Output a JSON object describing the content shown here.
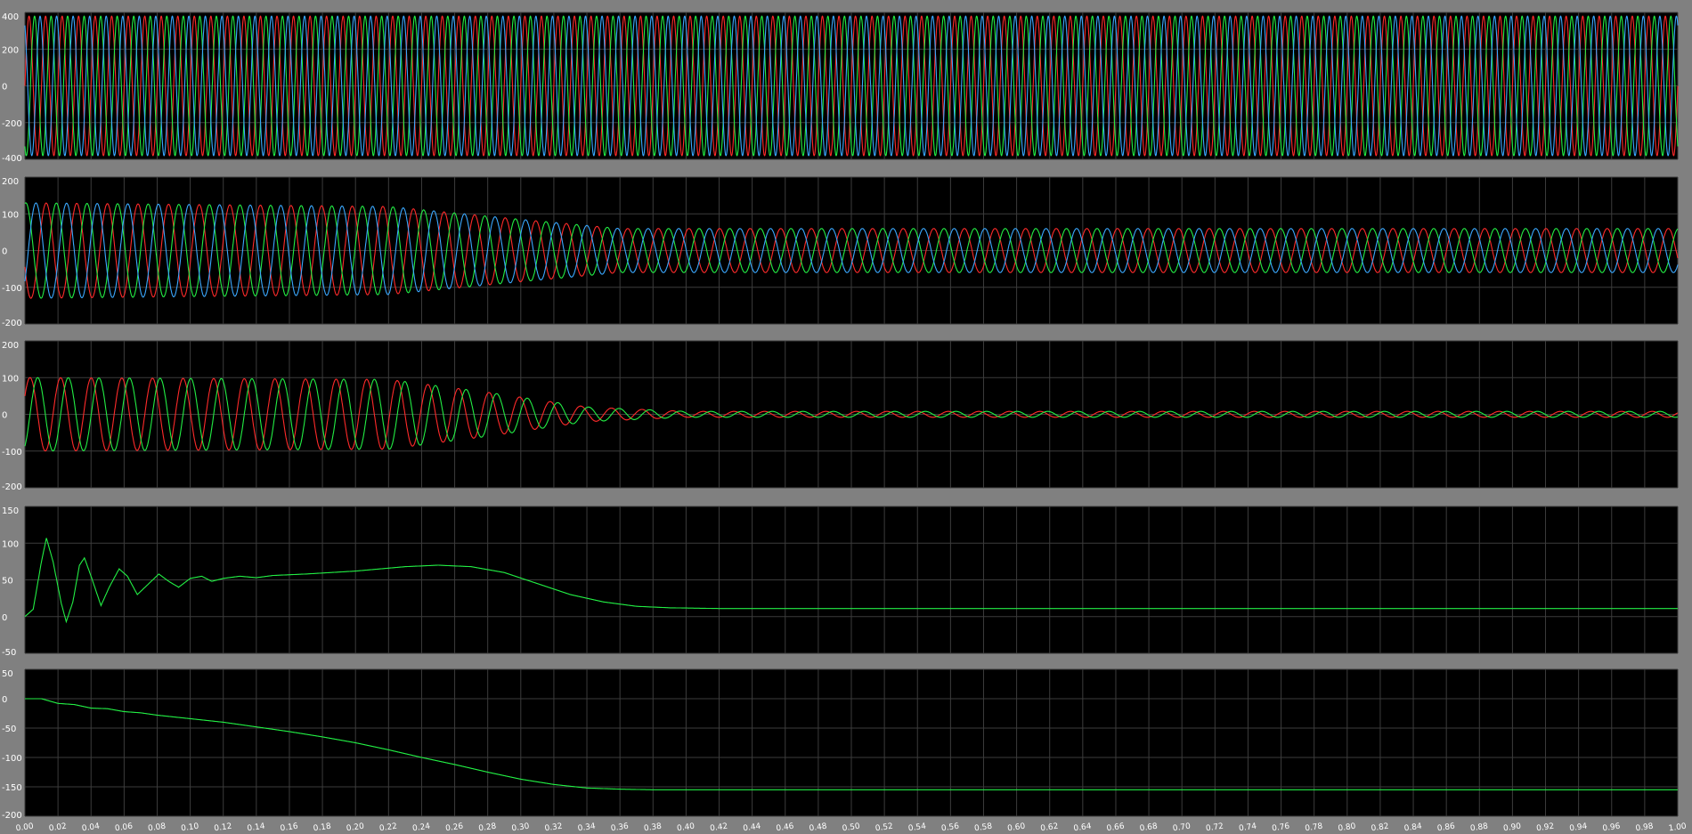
{
  "chart_data": [
    {
      "type": "line",
      "title": "",
      "xlabel": "",
      "ylabel": "",
      "xlim": [
        0,
        1.0
      ],
      "ylim": [
        -400,
        400
      ],
      "yticks": [
        400,
        200,
        0,
        -200,
        -400
      ],
      "ytick_labels": [
        "400",
        "200",
        "0",
        "-200",
        "-400"
      ],
      "grid": true,
      "series": [
        {
          "color": "#ff2a2a",
          "model": "sine",
          "amplitude": 380,
          "frequency_hz": 100,
          "phase_deg": 0
        },
        {
          "color": "#22ee44",
          "model": "sine",
          "amplitude": 380,
          "frequency_hz": 100,
          "phase_deg": -120
        },
        {
          "color": "#3aa8ff",
          "model": "sine",
          "amplitude": 380,
          "frequency_hz": 100,
          "phase_deg": 120
        }
      ]
    },
    {
      "type": "line",
      "title": "",
      "xlabel": "",
      "ylabel": "",
      "xlim": [
        0,
        1.0
      ],
      "ylim": [
        -200,
        200
      ],
      "yticks": [
        200,
        100,
        0,
        -100,
        -200
      ],
      "ytick_labels": [
        "200",
        "100",
        "0",
        "-100",
        "-200"
      ],
      "grid": true,
      "series": [
        {
          "color": "#ff2a2a",
          "model": "envelope_sine",
          "frequency_hz": 54,
          "phase_deg": 200,
          "envelope": [
            [
              0,
              130
            ],
            [
              0.22,
              120
            ],
            [
              0.3,
              85
            ],
            [
              0.36,
              60
            ],
            [
              1.0,
              60
            ]
          ]
        },
        {
          "color": "#22ee44",
          "model": "envelope_sine",
          "frequency_hz": 54,
          "phase_deg": 80,
          "envelope": [
            [
              0,
              130
            ],
            [
              0.22,
              120
            ],
            [
              0.3,
              85
            ],
            [
              0.36,
              60
            ],
            [
              1.0,
              60
            ]
          ]
        },
        {
          "color": "#3aa8ff",
          "model": "envelope_sine",
          "frequency_hz": 54,
          "phase_deg": -40,
          "envelope": [
            [
              0,
              130
            ],
            [
              0.22,
              120
            ],
            [
              0.3,
              85
            ],
            [
              0.36,
              60
            ],
            [
              1.0,
              60
            ]
          ]
        }
      ]
    },
    {
      "type": "line",
      "title": "",
      "xlabel": "",
      "ylabel": "",
      "xlim": [
        0,
        1.0
      ],
      "ylim": [
        -200,
        200
      ],
      "yticks": [
        200,
        100,
        0,
        -100,
        -200
      ],
      "ytick_labels": [
        "200",
        "100",
        "0",
        "-100",
        "-200"
      ],
      "grid": true,
      "series": [
        {
          "color": "#ff2a2a",
          "model": "envelope_sine",
          "frequency_hz": 54,
          "phase_deg": 30,
          "envelope": [
            [
              0,
              100
            ],
            [
              0.22,
              95
            ],
            [
              0.28,
              60
            ],
            [
              0.34,
              20
            ],
            [
              0.4,
              8
            ],
            [
              1.0,
              8
            ]
          ]
        },
        {
          "color": "#22ee44",
          "model": "envelope_sine",
          "frequency_hz": 54,
          "phase_deg": -60,
          "envelope": [
            [
              0,
              100
            ],
            [
              0.22,
              95
            ],
            [
              0.28,
              60
            ],
            [
              0.34,
              20
            ],
            [
              0.4,
              8
            ],
            [
              1.0,
              8
            ]
          ]
        }
      ]
    },
    {
      "type": "line",
      "title": "",
      "xlabel": "",
      "ylabel": "",
      "xlim": [
        0,
        1.0
      ],
      "ylim": [
        -50,
        150
      ],
      "yticks": [
        150,
        100,
        50,
        0,
        -50
      ],
      "ytick_labels": [
        "150",
        "100",
        "50",
        "0",
        "-50"
      ],
      "grid": true,
      "series": [
        {
          "color": "#22ee44",
          "model": "points",
          "points": [
            [
              0,
              0
            ],
            [
              0.005,
              10
            ],
            [
              0.01,
              75
            ],
            [
              0.013,
              107
            ],
            [
              0.017,
              75
            ],
            [
              0.022,
              18
            ],
            [
              0.025,
              -7
            ],
            [
              0.029,
              20
            ],
            [
              0.033,
              70
            ],
            [
              0.036,
              80
            ],
            [
              0.04,
              55
            ],
            [
              0.046,
              15
            ],
            [
              0.051,
              40
            ],
            [
              0.057,
              65
            ],
            [
              0.062,
              55
            ],
            [
              0.068,
              30
            ],
            [
              0.075,
              45
            ],
            [
              0.081,
              58
            ],
            [
              0.087,
              48
            ],
            [
              0.093,
              40
            ],
            [
              0.1,
              52
            ],
            [
              0.107,
              55
            ],
            [
              0.113,
              48
            ],
            [
              0.12,
              52
            ],
            [
              0.13,
              55
            ],
            [
              0.14,
              53
            ],
            [
              0.15,
              56
            ],
            [
              0.17,
              58
            ],
            [
              0.2,
              62
            ],
            [
              0.23,
              68
            ],
            [
              0.25,
              70
            ],
            [
              0.27,
              68
            ],
            [
              0.29,
              60
            ],
            [
              0.31,
              45
            ],
            [
              0.33,
              30
            ],
            [
              0.35,
              20
            ],
            [
              0.37,
              14
            ],
            [
              0.39,
              12
            ],
            [
              0.42,
              11
            ],
            [
              1.0,
              11
            ]
          ]
        }
      ]
    },
    {
      "type": "line",
      "title": "",
      "xlabel": "",
      "ylabel": "",
      "xlim": [
        0,
        1.0
      ],
      "ylim": [
        -200,
        50
      ],
      "yticks": [
        50,
        0,
        -50,
        -100,
        -150,
        -200
      ],
      "ytick_labels": [
        "50",
        "0",
        "-50",
        "-100",
        "-150",
        "-200"
      ],
      "grid": true,
      "series": [
        {
          "color": "#22ee44",
          "model": "points",
          "points": [
            [
              0,
              0
            ],
            [
              0.01,
              0
            ],
            [
              0.02,
              -8
            ],
            [
              0.03,
              -10
            ],
            [
              0.04,
              -16
            ],
            [
              0.05,
              -17
            ],
            [
              0.06,
              -22
            ],
            [
              0.07,
              -24
            ],
            [
              0.08,
              -28
            ],
            [
              0.1,
              -34
            ],
            [
              0.12,
              -40
            ],
            [
              0.14,
              -48
            ],
            [
              0.16,
              -56
            ],
            [
              0.18,
              -65
            ],
            [
              0.2,
              -75
            ],
            [
              0.22,
              -87
            ],
            [
              0.24,
              -100
            ],
            [
              0.26,
              -112
            ],
            [
              0.28,
              -125
            ],
            [
              0.3,
              -137
            ],
            [
              0.32,
              -146
            ],
            [
              0.34,
              -152
            ],
            [
              0.36,
              -154
            ],
            [
              0.38,
              -155
            ],
            [
              1.0,
              -155
            ]
          ]
        }
      ]
    }
  ],
  "xaxis": {
    "tick_labels": [
      "0.00",
      "0.02",
      "0.04",
      "0.06",
      "0.08",
      "0.10",
      "0.12",
      "0.14",
      "0.16",
      "0.18",
      "0.20",
      "0.22",
      "0.24",
      "0.26",
      "0.28",
      "0.30",
      "0.32",
      "0.34",
      "0.36",
      "0.38",
      "0.40",
      "0.42",
      "0.44",
      "0.46",
      "0.48",
      "0.50",
      "0.52",
      "0.54",
      "0.56",
      "0.58",
      "0.60",
      "0.62",
      "0.64",
      "0.66",
      "0.68",
      "0.70",
      "0.72",
      "0.74",
      "0.76",
      "0.78",
      "0.80",
      "0.82",
      "0.84",
      "0.86",
      "0.88",
      "0.90",
      "0.92",
      "0.94",
      "0.96",
      "0.98",
      "1.00"
    ]
  },
  "colors": {
    "background": "#808080",
    "plot_background": "#000000",
    "grid": "#3c3c3c",
    "tick_text": "#ffffff"
  }
}
